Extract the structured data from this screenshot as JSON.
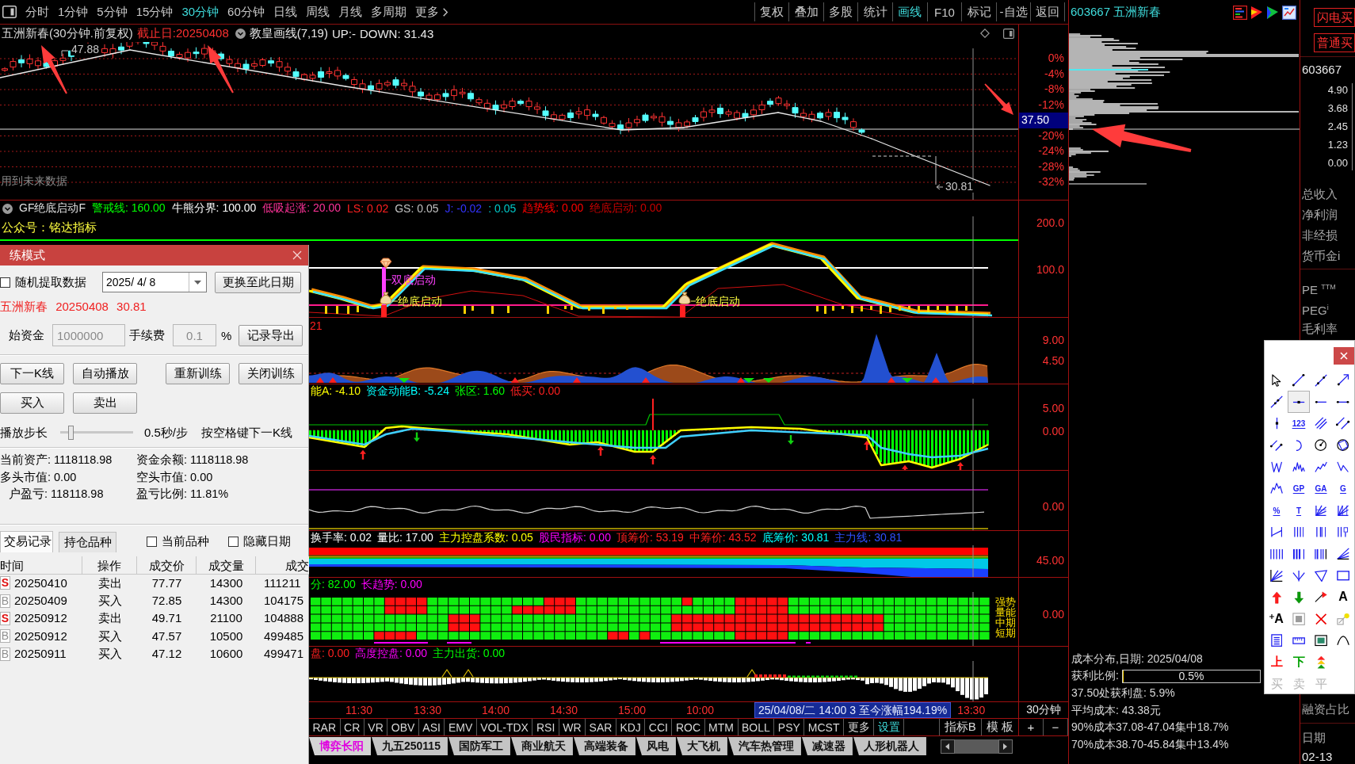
{
  "toolbar": {
    "periods": [
      {
        "label": "分时",
        "selected": false
      },
      {
        "label": "1分钟",
        "selected": false
      },
      {
        "label": "5分钟",
        "selected": false
      },
      {
        "label": "15分钟",
        "selected": false
      },
      {
        "label": "30分钟",
        "selected": true
      },
      {
        "label": "60分钟",
        "selected": false
      },
      {
        "label": "日线",
        "selected": false
      },
      {
        "label": "周线",
        "selected": false
      },
      {
        "label": "月线",
        "selected": false
      },
      {
        "label": "多周期",
        "selected": false
      }
    ],
    "more": "更多",
    "actions": [
      {
        "label": "复权",
        "selected": false
      },
      {
        "label": "叠加",
        "selected": false
      },
      {
        "label": "多股",
        "selected": false
      },
      {
        "label": "统计",
        "selected": false
      },
      {
        "label": "画线",
        "selected": true
      },
      {
        "label": "F10",
        "selected": false
      },
      {
        "label": "标记",
        "selected": false
      },
      {
        "label": "-自选",
        "selected": false
      },
      {
        "label": "返回",
        "selected": false
      }
    ]
  },
  "price_panel": {
    "title": "五洲新春(30分钟.前复权)",
    "cutoff": "截止日:20250408",
    "overlay": "教皇画线(7,19)",
    "readings": [
      "UP:-",
      "DOWN: 31.43"
    ],
    "high_label": "47.88",
    "low_label": "30.81",
    "note": "用到未来数据",
    "axis": [
      {
        "kind": "tick",
        "text": "0%"
      },
      {
        "kind": "tick",
        "text": "-4%"
      },
      {
        "kind": "tick",
        "text": "-8%"
      },
      {
        "kind": "tick",
        "text": "-12%"
      },
      {
        "kind": "current",
        "text": "37.50"
      },
      {
        "kind": "tick",
        "text": "-20%"
      },
      {
        "kind": "tick",
        "text": "-24%"
      },
      {
        "kind": "tick",
        "text": "-28%"
      },
      {
        "kind": "tick",
        "text": "-32%"
      }
    ]
  },
  "indicators": [
    {
      "kind": "signal",
      "name": "GF绝底启动F",
      "legend": [
        {
          "text": "警戒线: 160.00",
          "color": "#00ff00"
        },
        {
          "text": "牛熊分界: 100.00",
          "color": "#ffffff"
        },
        {
          "text": "低吸起涨: 20.00",
          "color": "#ff3399"
        },
        {
          "text": "LS: 0.02",
          "color": "#ff2020"
        },
        {
          "text": "GS: 0.05",
          "color": "#c0c0c0"
        },
        {
          "text": "J: -0.02",
          "color": "#3333ff"
        },
        {
          "text": ": 0.05",
          "color": "#00c8c8"
        },
        {
          "text": "趋势线: 0.00",
          "color": "#ff0000"
        },
        {
          "text": "绝底启动: 0.00",
          "color": "#c80000"
        }
      ],
      "subtitle": "公众号：铭达指标",
      "axis": [
        "200.0",
        "100.0"
      ],
      "signals": [
        {
          "label": "双底启动",
          "color": "#ff40ff"
        },
        {
          "label": "绝底启动",
          "color": "#ffff40"
        },
        {
          "label": "绝底启动",
          "color": "#ffff40"
        }
      ]
    },
    {
      "kind": "area",
      "legend": [
        {
          "text": "21",
          "color": "#ff2020"
        }
      ],
      "axis": [
        "9.00",
        "4.50"
      ]
    },
    {
      "kind": "momentum",
      "legend": [
        {
          "text": "能A: -4.10",
          "color": "#ffff00"
        },
        {
          "text": "资金动能B: -5.24",
          "color": "#00ffff"
        },
        {
          "text": "张区: 1.60",
          "color": "#00ff00"
        },
        {
          "text": "低买: 0.00",
          "color": "#ff2020"
        }
      ],
      "axis": [
        "5.00",
        "0.00"
      ]
    },
    {
      "kind": "line",
      "axis": [
        "0.00"
      ]
    },
    {
      "kind": "chips",
      "legend": [
        {
          "text": "换手率: 0.02",
          "color": "#ffffff"
        },
        {
          "text": "量比: 17.00",
          "color": "#ffffff"
        },
        {
          "text": "主力控盘系数: 0.05",
          "color": "#ffff00"
        },
        {
          "text": "股民指标: 0.00",
          "color": "#ff00ff"
        },
        {
          "text": "顶筹价: 53.19",
          "color": "#ff2020"
        },
        {
          "text": "中筹价: 43.52",
          "color": "#ff2020"
        },
        {
          "text": "底筹价: 30.81",
          "color": "#00ffff"
        },
        {
          "text": "主力线: 30.81",
          "color": "#3050ff"
        }
      ],
      "axis": [
        "45.00"
      ]
    },
    {
      "kind": "grid",
      "legend": [
        {
          "text": "分: 82.00",
          "color": "#00ff00"
        },
        {
          "text": "长趋势: 0.00",
          "color": "#ff00ff"
        }
      ],
      "axis": [
        "0.00"
      ],
      "rows": [
        "强势",
        "量能",
        "中期",
        "短期"
      ]
    },
    {
      "kind": "bars",
      "legend": [
        {
          "text": "盘: 0.00",
          "color": "#ff2020"
        },
        {
          "text": "高度控盘: 0.00",
          "color": "#ff00ff"
        },
        {
          "text": "主力出货: 0.00",
          "color": "#00ff00"
        }
      ]
    }
  ],
  "time_axis": {
    "labels": [
      "11:30",
      "13:30",
      "14:00",
      "14:30",
      "15:00",
      "10:00"
    ],
    "cursor": "25/04/08/二 14:00 3 至今涨幅194.19%",
    "end": "13:30",
    "period": "30分钟"
  },
  "indicator_tabs": {
    "items": [
      "RAR",
      "CR",
      "VR",
      "OBV",
      "ASI",
      "EMV",
      "VOL-TDX",
      "RSI",
      "WR",
      "SAR",
      "KDJ",
      "CCI",
      "ROC",
      "MTM",
      "BOLL",
      "PSY",
      "MCST",
      "更多"
    ],
    "settings": "设置",
    "right": [
      "指标B",
      "模 板"
    ],
    "zoom": [
      "+",
      "−"
    ]
  },
  "sector_tabs": [
    {
      "label": "博弈长阳",
      "selected": true
    },
    {
      "label": "九五250115",
      "selected": false
    },
    {
      "label": "国防军工",
      "selected": false
    },
    {
      "label": "商业航天",
      "selected": false
    },
    {
      "label": "高端装备",
      "selected": false
    },
    {
      "label": "风电",
      "selected": false
    },
    {
      "label": "大飞机",
      "selected": false
    },
    {
      "label": "汽车热管理",
      "selected": false
    },
    {
      "label": "减速器",
      "selected": false
    },
    {
      "label": "人形机器人",
      "selected": false
    }
  ],
  "cost_panel": {
    "header": "603667 五洲新春",
    "title": "成本分布,日期: 2025/04/08",
    "profit_label": "获利比例:",
    "profit": {
      "level": 0.005,
      "reading": "0.5%"
    },
    "lines": [
      "37.50处获利盘: 5.9%",
      "平均成本: 43.38元",
      "90%成本37.08-47.04集中18.7%",
      "70%成本38.70-45.84集中13.4%"
    ]
  },
  "side_panel": {
    "buttons": [
      "闪电买",
      "普通买"
    ],
    "code": "603667",
    "scale": [
      "4.90",
      "3.68",
      "2.45",
      "1.23",
      "0.00"
    ],
    "finance": [
      "总收入",
      "净利润",
      "非经损",
      "货币金i"
    ],
    "valuation": [
      "PE $^{TTM}$",
      "PEG$^{i}$",
      "毛利率"
    ],
    "margin": "融资占比",
    "date_label": "日期",
    "date": "02-13"
  },
  "drawing_toolbar": {
    "rows": [
      [
        {
          "kind": "icon",
          "selected": false,
          "disabled": false
        },
        {
          "kind": "icon",
          "selected": false,
          "disabled": false
        },
        {
          "kind": "icon",
          "selected": false,
          "disabled": false
        },
        {
          "kind": "icon",
          "selected": false,
          "disabled": false
        }
      ],
      [
        {
          "kind": "icon",
          "selected": false,
          "disabled": false
        },
        {
          "kind": "icon",
          "selected": true,
          "disabled": false
        },
        {
          "kind": "icon",
          "selected": false,
          "disabled": false
        },
        {
          "kind": "icon",
          "selected": false,
          "disabled": false
        }
      ],
      [
        {
          "kind": "icon",
          "selected": false,
          "disabled": false
        },
        {
          "kind": "tag",
          "label": "123",
          "selected": false,
          "disabled": false
        },
        {
          "kind": "icon",
          "selected": false,
          "disabled": false
        },
        {
          "kind": "icon",
          "selected": false,
          "disabled": false
        }
      ],
      [
        {
          "kind": "icon",
          "selected": false,
          "disabled": false
        },
        {
          "kind": "icon",
          "selected": false,
          "disabled": false
        },
        {
          "kind": "icon",
          "selected": false,
          "disabled": false
        },
        {
          "kind": "icon",
          "selected": false,
          "disabled": false
        }
      ],
      [
        {
          "kind": "icon",
          "selected": false,
          "disabled": false
        },
        {
          "kind": "icon",
          "selected": false,
          "disabled": false
        },
        {
          "kind": "icon",
          "selected": false,
          "disabled": false
        },
        {
          "kind": "icon",
          "selected": false,
          "disabled": false
        }
      ],
      [
        {
          "kind": "icon",
          "selected": false,
          "disabled": false
        },
        {
          "kind": "tag",
          "label": "GP",
          "selected": false,
          "disabled": false
        },
        {
          "kind": "tag",
          "label": "GA",
          "selected": false,
          "disabled": false
        },
        {
          "kind": "tag",
          "label": "G",
          "selected": false,
          "disabled": false
        }
      ],
      [
        {
          "kind": "tag",
          "label": "%",
          "selected": false,
          "disabled": false
        },
        {
          "kind": "tag",
          "label": "T",
          "selected": false,
          "disabled": false
        },
        {
          "kind": "icon",
          "selected": false,
          "disabled": false
        },
        {
          "kind": "icon",
          "selected": false,
          "disabled": false
        }
      ],
      [
        {
          "kind": "icon",
          "selected": false,
          "disabled": false
        },
        {
          "kind": "icon",
          "selected": false,
          "disabled": false
        },
        {
          "kind": "icon",
          "selected": false,
          "disabled": false
        },
        {
          "kind": "icon",
          "selected": false,
          "disabled": false
        }
      ],
      [
        {
          "kind": "icon",
          "selected": false,
          "disabled": false
        },
        {
          "kind": "icon",
          "selected": false,
          "disabled": false
        },
        {
          "kind": "icon",
          "selected": false,
          "disabled": false
        },
        {
          "kind": "icon",
          "selected": false,
          "disabled": false
        }
      ],
      [
        {
          "kind": "icon",
          "selected": false,
          "disabled": false
        },
        {
          "kind": "icon",
          "selected": false,
          "disabled": false
        },
        {
          "kind": "icon",
          "selected": false,
          "disabled": false
        },
        {
          "kind": "icon",
          "selected": false,
          "disabled": false
        }
      ],
      [
        {
          "kind": "icon",
          "selected": false,
          "disabled": false
        },
        {
          "kind": "icon",
          "selected": false,
          "disabled": false
        },
        {
          "kind": "icon",
          "selected": false,
          "disabled": false
        },
        {
          "kind": "glyph",
          "label": "A",
          "selected": false,
          "disabled": false
        }
      ],
      [
        {
          "kind": "glyph_add",
          "label": "A",
          "selected": false,
          "disabled": false
        },
        {
          "kind": "icon",
          "selected": false,
          "disabled": false
        },
        {
          "kind": "icon",
          "selected": false,
          "disabled": false
        },
        {
          "kind": "icon",
          "selected": false,
          "disabled": false
        }
      ],
      [
        {
          "kind": "icon",
          "selected": false,
          "disabled": false
        },
        {
          "kind": "icon",
          "selected": false,
          "disabled": false
        },
        {
          "kind": "icon",
          "selected": false,
          "disabled": false
        },
        {
          "kind": "icon",
          "selected": false,
          "disabled": false
        }
      ],
      [
        {
          "kind": "char",
          "label": "上",
          "color": "#ff0000",
          "selected": false,
          "disabled": false
        },
        {
          "kind": "char",
          "label": "下",
          "color": "#00a000",
          "selected": false,
          "disabled": false
        },
        {
          "kind": "icon",
          "selected": false,
          "disabled": false
        }
      ],
      [
        {
          "kind": "char",
          "label": "买",
          "selected": false,
          "disabled": true
        },
        {
          "kind": "char",
          "label": "卖",
          "selected": false,
          "disabled": true
        },
        {
          "kind": "char",
          "label": "平",
          "selected": false,
          "disabled": true
        }
      ]
    ]
  },
  "training_dialog": {
    "title": "练模式",
    "random_checkbox": {
      "label": "随机提取数据",
      "checked": false
    },
    "date": "2025/ 4/ 8",
    "change_date_button": "更换至此日期",
    "stock_line": "五洲新春 20250408 30.81",
    "capital_label": "始资金",
    "capital": {
      "value": "1000000",
      "disabled": true
    },
    "fee_label": "手续费",
    "fee": {
      "value": "0.1",
      "disabled": true
    },
    "fee_unit": "%",
    "export_button": "记录导出",
    "buttons": [
      [
        "下一K线",
        "自动播放",
        "重新训练",
        "关闭训练"
      ],
      [
        "买入",
        "卖出"
      ]
    ],
    "speed": {
      "label": "播放步长",
      "level": 0.15,
      "reading": "0.5秒/步",
      "hint": "按空格键下一K线"
    },
    "stats": [
      [
        "当前资产: 1118118.98",
        "资金余额: 1118118.98"
      ],
      [
        "多头市值: 0.00",
        "空头市值: 0.00"
      ],
      [
        "户盈亏: 118118.98",
        "盈亏比例: 11.81%"
      ]
    ],
    "tabs": [
      {
        "label": "交易记录",
        "selected": true
      },
      {
        "label": "持仓品种",
        "selected": false
      }
    ],
    "filters": [
      {
        "label": "当前品种",
        "checked": false
      },
      {
        "label": "隐藏日期",
        "checked": false
      }
    ],
    "table": {
      "columns": [
        "时间",
        "操作",
        "成交价",
        "成交量",
        "成交"
      ],
      "rows": [
        {
          "kind": "sell",
          "badge": "S",
          "cells": [
            "20250410",
            "卖出",
            "77.77",
            "14300",
            "111211"
          ]
        },
        {
          "kind": "buy",
          "badge": "B",
          "cells": [
            "20250409",
            "买入",
            "72.85",
            "14300",
            "104175"
          ]
        },
        {
          "kind": "sell",
          "badge": "S",
          "cells": [
            "20250912",
            "卖出",
            "49.71",
            "21100",
            "104888"
          ]
        },
        {
          "kind": "buy",
          "badge": "B",
          "cells": [
            "20250912",
            "买入",
            "47.57",
            "10500",
            "499485"
          ]
        },
        {
          "kind": "buy",
          "badge": "B",
          "cells": [
            "20250911",
            "买入",
            "47.12",
            "10600",
            "499471"
          ]
        }
      ]
    }
  }
}
